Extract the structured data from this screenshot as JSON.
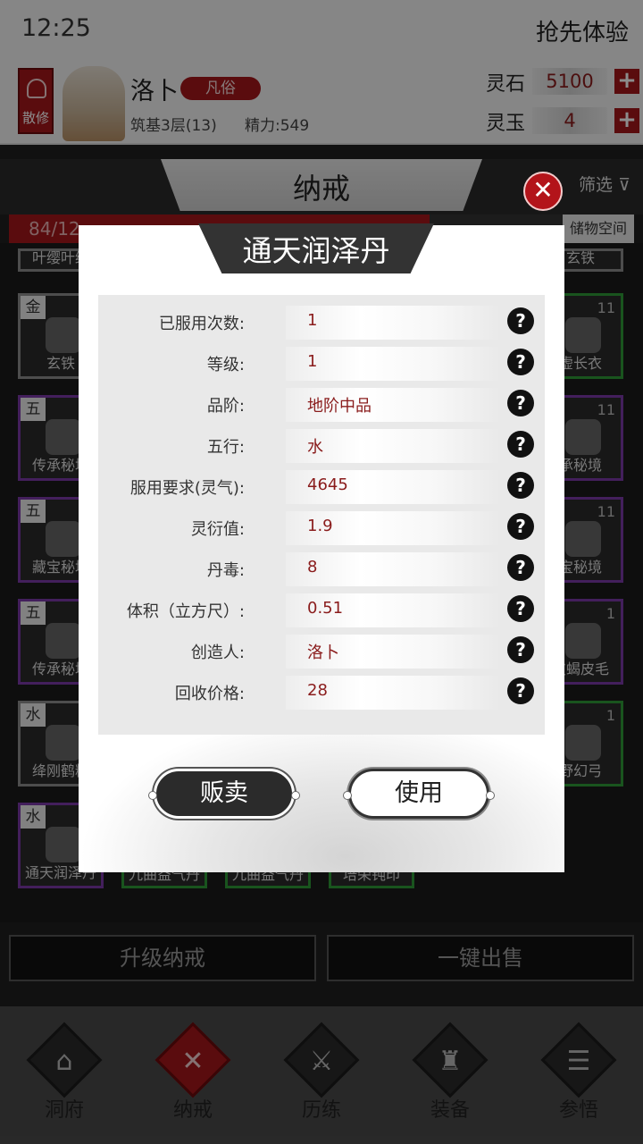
{
  "statusbar": {
    "time": "12:25",
    "promo": "抢先体验"
  },
  "profile": {
    "sect": "散修",
    "name": "洛卜",
    "rank": "凡俗",
    "level": "筑基3层(13)",
    "energy": "精力:549",
    "resources": [
      {
        "label": "灵石",
        "value": "5100"
      },
      {
        "label": "灵玉",
        "value": "4"
      }
    ],
    "plus": "+"
  },
  "bag": {
    "title": "纳戒",
    "filter": "筛选 ⊽",
    "capacity": "84/12",
    "capacity_fill": 0.76,
    "storage": "储物空间",
    "close": "✕"
  },
  "grid": {
    "left": [
      {
        "tag": "",
        "name": "叶缨叶缨",
        "count": ""
      },
      {
        "tag": "金",
        "name": "玄铁",
        "count": ""
      },
      {
        "tag": "五",
        "name": "传承秘境",
        "count": ""
      },
      {
        "tag": "五",
        "name": "藏宝秘境",
        "count": ""
      },
      {
        "tag": "五",
        "name": "传承秘境",
        "count": ""
      },
      {
        "tag": "水",
        "name": "绛刚鹤精",
        "count": ""
      },
      {
        "tag": "水",
        "name": "通天润泽丹",
        "count": ""
      }
    ],
    "right": [
      {
        "name": "玄铁",
        "count": ""
      },
      {
        "name": "虚长衣",
        "count": "11"
      },
      {
        "name": "承秘境",
        "count": "11"
      },
      {
        "name": "宝秘境",
        "count": "11"
      },
      {
        "name": "皮蝎皮毛",
        "count": "1"
      },
      {
        "name": "野幻弓",
        "count": "1"
      }
    ],
    "bottom_row": [
      "九曲益气丹",
      "九曲益气丹",
      "培荣钝印"
    ]
  },
  "actions": {
    "upgrade": "升级纳戒",
    "sell_all": "一键出售"
  },
  "nav": [
    {
      "label": "洞府",
      "glyph": "⌂"
    },
    {
      "label": "纳戒",
      "glyph": "✕"
    },
    {
      "label": "历练",
      "glyph": "⚔"
    },
    {
      "label": "装备",
      "glyph": "♜"
    },
    {
      "label": "参悟",
      "glyph": "☰"
    }
  ],
  "modal": {
    "title": "通天润泽丹",
    "help": "?",
    "properties": [
      {
        "key": "已服用次数:",
        "value": "1"
      },
      {
        "key": "等级:",
        "value": "1"
      },
      {
        "key": "品阶:",
        "value": "地阶中品"
      },
      {
        "key": "五行:",
        "value": "水"
      },
      {
        "key": "服用要求(灵气):",
        "value": "4645"
      },
      {
        "key": "灵衍值:",
        "value": "1.9"
      },
      {
        "key": "丹毒:",
        "value": "8"
      },
      {
        "key": "体积（立方尺）:",
        "value": "0.51"
      },
      {
        "key": "创造人:",
        "value": "洛卜"
      },
      {
        "key": "回收价格:",
        "value": "28"
      }
    ],
    "sell_label": "贩卖",
    "use_label": "使用"
  }
}
